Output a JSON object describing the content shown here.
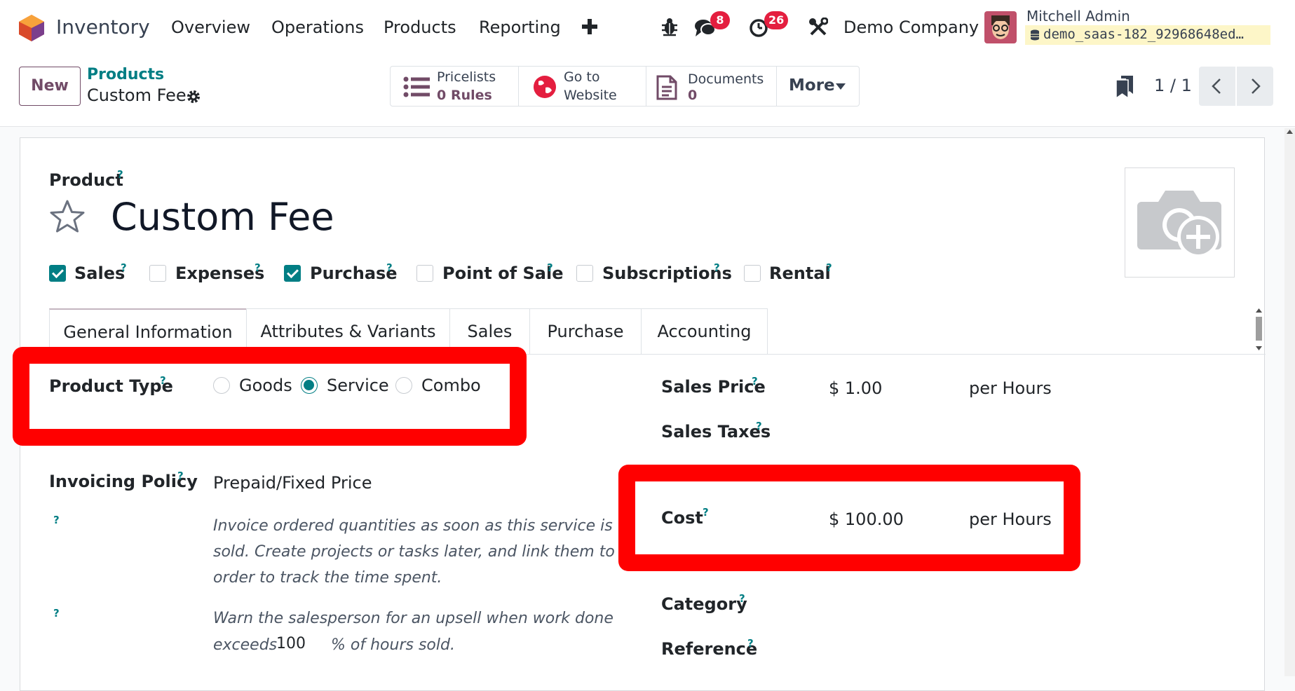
{
  "navbar": {
    "app_name": "Inventory",
    "menu": [
      "Overview",
      "Operations",
      "Products",
      "Reporting"
    ],
    "plus_icon": "plus-icon",
    "messages_count": "8",
    "activities_count": "26",
    "company": "Demo Company",
    "user_name": "Mitchell Admin",
    "database": "demo_saas-182_92968648ed…"
  },
  "control": {
    "new_label": "New",
    "breadcrumb_parent": "Products",
    "breadcrumb_current": "Custom Fee",
    "stat_buttons": {
      "pricelists_line1": "Pricelists",
      "pricelists_count": "0",
      "pricelists_line2": "Rules",
      "website_line1": "Go to",
      "website_line2": "Website",
      "documents_line1": "Documents",
      "documents_count": "0",
      "more": "More"
    },
    "pager": "1 / 1"
  },
  "form": {
    "product_label": "Product",
    "help_mark": "?",
    "product_name": "Custom Fee",
    "checkboxes": [
      {
        "label": "Sales",
        "checked": true
      },
      {
        "label": "Expenses",
        "checked": false
      },
      {
        "label": "Purchase",
        "checked": true
      },
      {
        "label": "Point of Sale",
        "checked": false
      },
      {
        "label": "Subscriptions",
        "checked": false
      },
      {
        "label": "Rental",
        "checked": false
      }
    ],
    "tabs": [
      "General Information",
      "Attributes & Variants",
      "Sales",
      "Purchase",
      "Accounting"
    ],
    "product_type": {
      "label": "Product Type",
      "options": [
        "Goods",
        "Service",
        "Combo"
      ],
      "selected": "Service"
    },
    "invoicing_policy": {
      "label": "Invoicing Policy",
      "value": "Prepaid/Fixed Price",
      "help_text": "Invoice ordered quantities as soon as this service is sold. Create projects or tasks later, and link them to order to track the time spent."
    },
    "upsell": {
      "text_line1": "Warn the salesperson for an upsell when work done",
      "text_prefix": "exceeds",
      "value": "100",
      "text_suffix": "% of hours sold."
    },
    "sales_price": {
      "label": "Sales Price",
      "value": "$ 1.00",
      "unit": "per Hours"
    },
    "sales_taxes": {
      "label": "Sales Taxes"
    },
    "cost": {
      "label": "Cost",
      "value": "$ 100.00",
      "unit": "per Hours"
    },
    "category": {
      "label": "Category"
    },
    "reference": {
      "label": "Reference"
    }
  },
  "colors": {
    "brand": "#714b67",
    "accent": "#017e84",
    "badge": "#e41e3f",
    "highlight": "#ff0000"
  }
}
